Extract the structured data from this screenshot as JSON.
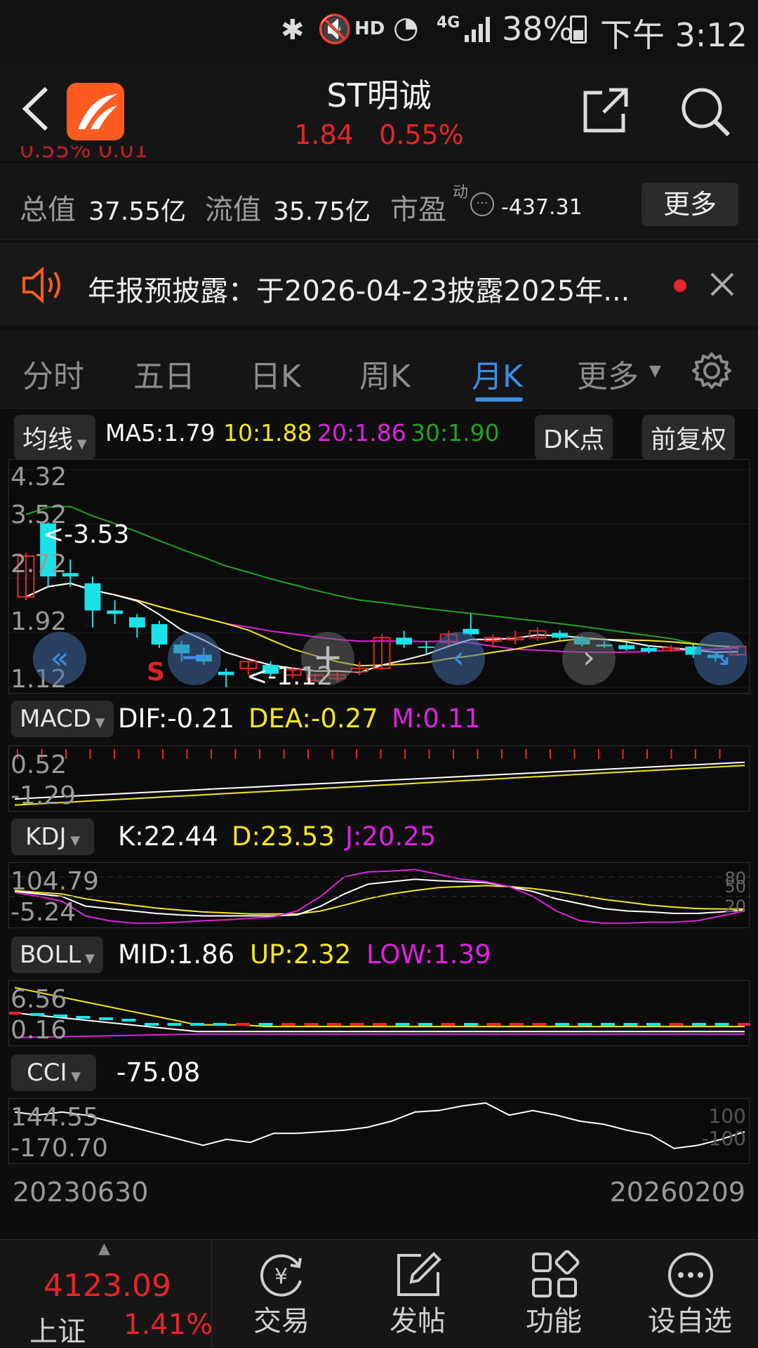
{
  "status_bar": {
    "hd": "HD",
    "net": "4G",
    "battery": "38%",
    "time": "下午 3:12"
  },
  "header": {
    "title": "ST明诚",
    "price": "1.84",
    "change_pct": "0.55%"
  },
  "stats": {
    "partial_row": "0.55% 0.01",
    "total_label": "总值",
    "total_value": "37.55亿",
    "float_label": "流值",
    "float_value": "35.75亿",
    "pe_label": "市盈",
    "pe_sup": "动",
    "pe_value": "-437.31",
    "more_button": "更多"
  },
  "notice": {
    "text": "年报预披露：于2026-04-23披露2025年..."
  },
  "tabs": [
    {
      "label": "分时",
      "active": false
    },
    {
      "label": "五日",
      "active": false
    },
    {
      "label": "日K",
      "active": false
    },
    {
      "label": "周K",
      "active": false
    },
    {
      "label": "月K",
      "active": true
    },
    {
      "label": "更多",
      "active": false
    }
  ],
  "ma_legend": {
    "selector": "均线",
    "ma5": "MA5:1.79",
    "ma10": "10:1.88",
    "ma20": "20:1.86",
    "ma30": "30:1.90",
    "dk_button": "DK点",
    "adjust_button": "前复权"
  },
  "kline": {
    "y_labels": [
      "4.32",
      "3.52",
      "2.72",
      "1.92",
      "1.12"
    ],
    "high_annotation": "<-3.53",
    "low_annotation": "<-1.12",
    "sell_marker": "S"
  },
  "macd": {
    "selector": "MACD",
    "dif": "DIF:-0.21",
    "dea": "DEA:-0.27",
    "m": "M:0.11",
    "y_labels": [
      "0.52",
      "-1.29"
    ]
  },
  "kdj": {
    "selector": "KDJ",
    "k": "K:22.44",
    "d": "D:23.53",
    "j": "J:20.25",
    "y_labels": [
      "104.79",
      "-5.24"
    ],
    "right_labels": [
      "80",
      "50",
      "20"
    ]
  },
  "boll": {
    "selector": "BOLL",
    "mid": "MID:1.86",
    "up": "UP:2.32",
    "low": "LOW:1.39",
    "y_labels": [
      "6.56",
      "0.16"
    ]
  },
  "cci": {
    "selector": "CCI",
    "value": "-75.08",
    "y_labels": [
      "144.55",
      "-170.70"
    ],
    "right_labels": [
      "100",
      "-100"
    ]
  },
  "date_range": {
    "start": "20230630",
    "end": "20260209"
  },
  "bottom_bar": {
    "index_value": "4123.09",
    "index_name": "上证",
    "index_pct": "1.41%",
    "items": [
      {
        "label": "交易",
        "icon": "yuan-exchange-icon"
      },
      {
        "label": "发帖",
        "icon": "edit-icon"
      },
      {
        "label": "功能",
        "icon": "grid-icon"
      },
      {
        "label": "设自选",
        "icon": "more-dots-icon"
      }
    ]
  },
  "colors": {
    "up": "#e8242a",
    "down": "#19e3e8",
    "ma5": "#ffffff",
    "ma10": "#f5e61e",
    "ma20": "#e020e0",
    "ma30": "#1fa31f",
    "accent": "#3a8ee6",
    "brand": "#ff5a1f"
  },
  "chart_data": {
    "type": "candlestick",
    "period": "monthly",
    "x_start": "20230630",
    "x_end": "20260209",
    "ylim": [
      1.12,
      4.32
    ],
    "candles": [
      {
        "o": 3.05,
        "c": 2.45,
        "h": 3.1,
        "l": 2.4,
        "up": true
      },
      {
        "o": 3.53,
        "c": 2.75,
        "h": 3.55,
        "l": 2.6,
        "up": false
      },
      {
        "o": 2.8,
        "c": 2.75,
        "h": 3.0,
        "l": 2.6,
        "up": false
      },
      {
        "o": 2.65,
        "c": 2.25,
        "h": 2.75,
        "l": 2.0,
        "up": false
      },
      {
        "o": 2.25,
        "c": 2.2,
        "h": 2.4,
        "l": 2.05,
        "up": false
      },
      {
        "o": 2.15,
        "c": 2.0,
        "h": 2.2,
        "l": 1.85,
        "up": false
      },
      {
        "o": 2.05,
        "c": 1.75,
        "h": 2.1,
        "l": 1.7,
        "up": false
      },
      {
        "o": 1.75,
        "c": 1.62,
        "h": 1.8,
        "l": 1.5,
        "up": false
      },
      {
        "o": 1.6,
        "c": 1.5,
        "h": 1.7,
        "l": 1.45,
        "up": false
      },
      {
        "o": 1.35,
        "c": 1.3,
        "h": 1.4,
        "l": 1.12,
        "up": false
      },
      {
        "o": 1.4,
        "c": 1.5,
        "h": 1.5,
        "l": 1.3,
        "up": true
      },
      {
        "o": 1.45,
        "c": 1.32,
        "h": 1.5,
        "l": 1.28,
        "up": false
      },
      {
        "o": 1.3,
        "c": 1.38,
        "h": 1.42,
        "l": 1.25,
        "up": true
      },
      {
        "o": 1.22,
        "c": 1.3,
        "h": 1.32,
        "l": 1.2,
        "up": true
      },
      {
        "o": 1.25,
        "c": 1.3,
        "h": 1.35,
        "l": 1.2,
        "up": true
      },
      {
        "o": 1.35,
        "c": 1.4,
        "h": 1.5,
        "l": 1.3,
        "up": true
      },
      {
        "o": 1.4,
        "c": 1.85,
        "h": 1.9,
        "l": 1.38,
        "up": true
      },
      {
        "o": 1.85,
        "c": 1.75,
        "h": 1.95,
        "l": 1.7,
        "up": false
      },
      {
        "o": 1.7,
        "c": 1.72,
        "h": 1.8,
        "l": 1.6,
        "up": false
      },
      {
        "o": 1.78,
        "c": 1.9,
        "h": 1.95,
        "l": 1.74,
        "up": true
      },
      {
        "o": 1.98,
        "c": 1.9,
        "h": 2.2,
        "l": 1.88,
        "up": false
      },
      {
        "o": 1.8,
        "c": 1.85,
        "h": 1.9,
        "l": 1.7,
        "up": true
      },
      {
        "o": 1.82,
        "c": 1.85,
        "h": 1.95,
        "l": 1.75,
        "up": true
      },
      {
        "o": 1.85,
        "c": 1.95,
        "h": 2.0,
        "l": 1.8,
        "up": true
      },
      {
        "o": 1.92,
        "c": 1.85,
        "h": 1.96,
        "l": 1.82,
        "up": false
      },
      {
        "o": 1.85,
        "c": 1.75,
        "h": 1.88,
        "l": 1.72,
        "up": false
      },
      {
        "o": 1.75,
        "c": 1.72,
        "h": 1.8,
        "l": 1.7,
        "up": false
      },
      {
        "o": 1.74,
        "c": 1.68,
        "h": 1.78,
        "l": 1.66,
        "up": false
      },
      {
        "o": 1.7,
        "c": 1.65,
        "h": 1.74,
        "l": 1.62,
        "up": false
      },
      {
        "o": 1.66,
        "c": 1.7,
        "h": 1.74,
        "l": 1.64,
        "up": true
      },
      {
        "o": 1.72,
        "c": 1.6,
        "h": 1.75,
        "l": 1.55,
        "up": false
      },
      {
        "o": 1.6,
        "c": 1.55,
        "h": 1.65,
        "l": 1.5,
        "up": false
      },
      {
        "o": 1.6,
        "c": 1.72,
        "h": 1.74,
        "l": 1.58,
        "up": true
      }
    ]
  }
}
